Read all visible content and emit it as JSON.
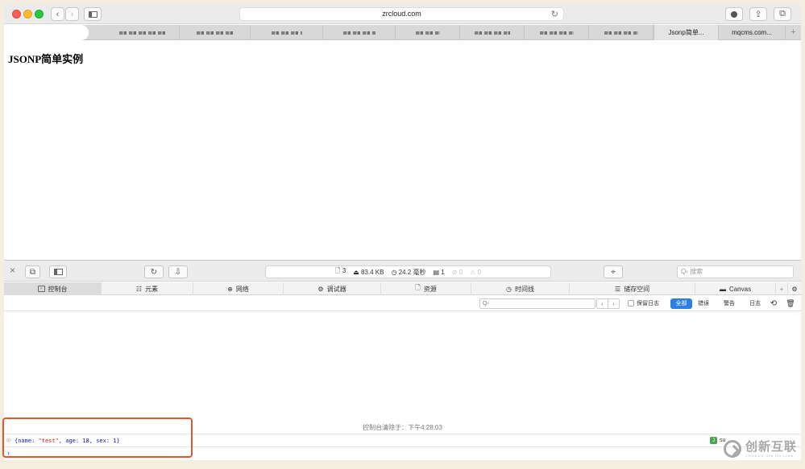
{
  "browser": {
    "url": "zrcloud.com",
    "tabs": [
      {
        "label": "Jsonp简单..."
      },
      {
        "label": "mqcms.com..."
      }
    ],
    "new_tab_label": "+"
  },
  "page": {
    "heading": "JSONP简单实例"
  },
  "devtools": {
    "stats": {
      "resources": "3",
      "size": "83.4 KB",
      "time": "24.2 毫秒",
      "logs": "1",
      "errors": "0",
      "warnings": "0"
    },
    "search_placeholder": "Q‹ 搜索",
    "tabs": [
      {
        "label": "控制台",
        "icon": "console-icon"
      },
      {
        "label": "元素",
        "icon": "elements-icon"
      },
      {
        "label": "网络",
        "icon": "network-icon"
      },
      {
        "label": "调试器",
        "icon": "debugger-icon"
      },
      {
        "label": "资源",
        "icon": "resources-icon"
      },
      {
        "label": "时间线",
        "icon": "timeline-icon"
      },
      {
        "label": "储存空间",
        "icon": "storage-icon"
      },
      {
        "label": "Canvas",
        "icon": "canvas-icon"
      }
    ],
    "filter_placeholder": "Q‹",
    "keep_log_label": "保留日志",
    "filters": [
      "全部",
      "错误",
      "警告",
      "日志"
    ],
    "cleared_message": "控制台清除于：下午4:28:03",
    "log_entry": {
      "open": "{",
      "k1": "name",
      "v1": "\"test\"",
      "k2": "age",
      "v2": "18",
      "k3": "sex",
      "v3": "1",
      "close": "}"
    },
    "log_source": "su",
    "prompt_symbol": "›"
  },
  "watermark": {
    "text": "创新互联",
    "sub": "CHUANG XIN HU LIAN"
  },
  "colors": {
    "accent": "#2d7fe5",
    "highlight_border": "#e0572c"
  }
}
